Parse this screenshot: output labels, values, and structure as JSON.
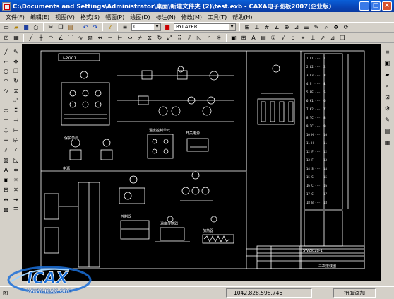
{
  "window": {
    "title": "C:\\Documents and Settings\\Administrator\\桌面\\新建文件夹 (2)\\test.exb - CAXA电子图板2007(企业版)",
    "min_glyph": "_",
    "max_glyph": "□",
    "close_glyph": "×"
  },
  "menu": {
    "items": [
      "文件(F)",
      "编辑(E)",
      "视图(V)",
      "格式(S)",
      "幅面(P)",
      "绘图(D)",
      "标注(N)",
      "修改(M)",
      "工具(T)",
      "帮助(H)"
    ]
  },
  "toolbar": {
    "layer_value": "0",
    "linetype_value": "BYLAYER"
  },
  "drawing": {
    "title_block_code": "I-2001",
    "diagram_labels": [
      "温度控制单元",
      "电源",
      "保护单元",
      "二次接线图",
      "开关电源",
      "温度传感器",
      "加热器",
      "控制器"
    ],
    "bottom_table_code": "SWZJ02B-1"
  },
  "status": {
    "left_text": "图",
    "coordinates": "1042.828,598.746",
    "mode": "抬取添加"
  },
  "watermark": {
    "brand": "ICAX",
    "url": "WWW.ICAX.ORG"
  },
  "colors": {
    "title_bar": "#0a4fc8",
    "canvas": "#000000",
    "drawing_lines": "#ffffff",
    "chrome": "#d4d0c8",
    "watermark_blue": "#1a6fd8"
  }
}
